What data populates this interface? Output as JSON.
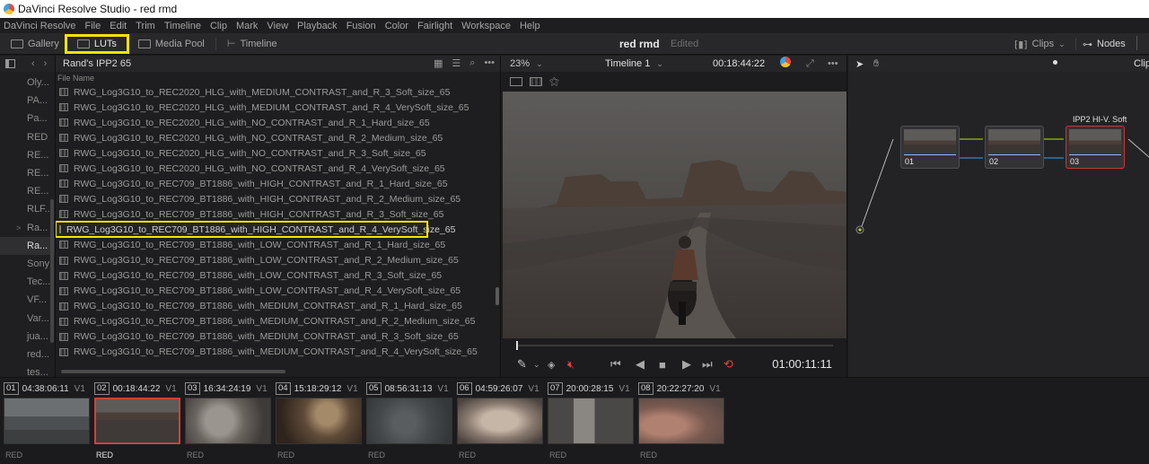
{
  "window": {
    "title": "DaVinci Resolve Studio - red rmd"
  },
  "menu": [
    "DaVinci Resolve",
    "File",
    "Edit",
    "Trim",
    "Timeline",
    "Clip",
    "Mark",
    "View",
    "Playback",
    "Fusion",
    "Color",
    "Fairlight",
    "Workspace",
    "Help"
  ],
  "toolbar": {
    "gallery": "Gallery",
    "luts": "LUTs",
    "media_pool": "Media Pool",
    "timeline": "Timeline",
    "project_name": "red rmd",
    "project_status": "Edited",
    "clips": "Clips",
    "nodes": "Nodes"
  },
  "bins": [
    {
      "label": "Oly..."
    },
    {
      "label": "PA..."
    },
    {
      "label": "Pa..."
    },
    {
      "label": "RED"
    },
    {
      "label": "RE..."
    },
    {
      "label": "RE..."
    },
    {
      "label": "RE..."
    },
    {
      "label": "RLF..."
    },
    {
      "label": "Ra..."
    },
    {
      "label": "Ra..."
    },
    {
      "label": "Sony"
    },
    {
      "label": "Tec..."
    },
    {
      "label": "VF..."
    },
    {
      "label": "Var..."
    },
    {
      "label": "jua..."
    },
    {
      "label": "red..."
    },
    {
      "label": "tes..."
    }
  ],
  "lut_panel": {
    "title": "Rand's IPP2 65",
    "column_header": "File Name",
    "files": [
      "RWG_Log3G10_to_REC2020_HLG_with_MEDIUM_CONTRAST_and_R_3_Soft_size_65",
      "RWG_Log3G10_to_REC2020_HLG_with_MEDIUM_CONTRAST_and_R_4_VerySoft_size_65",
      "RWG_Log3G10_to_REC2020_HLG_with_NO_CONTRAST_and_R_1_Hard_size_65",
      "RWG_Log3G10_to_REC2020_HLG_with_NO_CONTRAST_and_R_2_Medium_size_65",
      "RWG_Log3G10_to_REC2020_HLG_with_NO_CONTRAST_and_R_3_Soft_size_65",
      "RWG_Log3G10_to_REC2020_HLG_with_NO_CONTRAST_and_R_4_VerySoft_size_65",
      "RWG_Log3G10_to_REC709_BT1886_with_HIGH_CONTRAST_and_R_1_Hard_size_65",
      "RWG_Log3G10_to_REC709_BT1886_with_HIGH_CONTRAST_and_R_2_Medium_size_65",
      "RWG_Log3G10_to_REC709_BT1886_with_HIGH_CONTRAST_and_R_3_Soft_size_65",
      "RWG_Log3G10_to_REC709_BT1886_with_HIGH_CONTRAST_and_R_4_VerySoft_size_65",
      "RWG_Log3G10_to_REC709_BT1886_with_LOW_CONTRAST_and_R_1_Hard_size_65",
      "RWG_Log3G10_to_REC709_BT1886_with_LOW_CONTRAST_and_R_2_Medium_size_65",
      "RWG_Log3G10_to_REC709_BT1886_with_LOW_CONTRAST_and_R_3_Soft_size_65",
      "RWG_Log3G10_to_REC709_BT1886_with_LOW_CONTRAST_and_R_4_VerySoft_size_65",
      "RWG_Log3G10_to_REC709_BT1886_with_MEDIUM_CONTRAST_and_R_1_Hard_size_65",
      "RWG_Log3G10_to_REC709_BT1886_with_MEDIUM_CONTRAST_and_R_2_Medium_size_65",
      "RWG_Log3G10_to_REC709_BT1886_with_MEDIUM_CONTRAST_and_R_3_Soft_size_65",
      "RWG_Log3G10_to_REC709_BT1886_with_MEDIUM_CONTRAST_and_R_4_VerySoft_size_65"
    ]
  },
  "viewer": {
    "zoom": "23%",
    "timeline_name": "Timeline 1",
    "timecode_top": "00:18:44:22",
    "timecode": "01:00:11:11"
  },
  "node_editor": {
    "panel_label": "Clip",
    "node_title": "IPP2 HI-V. Soft",
    "nodes": [
      {
        "num": "01"
      },
      {
        "num": "02"
      },
      {
        "num": "03"
      }
    ]
  },
  "clips": [
    {
      "num": "01",
      "tc": "04:38:06:11",
      "track": "V1",
      "codec": "RED"
    },
    {
      "num": "02",
      "tc": "00:18:44:22",
      "track": "V1",
      "codec": "RED"
    },
    {
      "num": "03",
      "tc": "16:34:24:19",
      "track": "V1",
      "codec": "RED"
    },
    {
      "num": "04",
      "tc": "15:18:29:12",
      "track": "V1",
      "codec": "RED"
    },
    {
      "num": "05",
      "tc": "08:56:31:13",
      "track": "V1",
      "codec": "RED"
    },
    {
      "num": "06",
      "tc": "04:59:26:07",
      "track": "V1",
      "codec": "RED"
    },
    {
      "num": "07",
      "tc": "20:00:28:15",
      "track": "V1",
      "codec": "RED"
    },
    {
      "num": "08",
      "tc": "20:22:27:20",
      "track": "V1",
      "codec": "RED"
    }
  ],
  "colors": {
    "highlight": "#f5e400",
    "selection_red": "#cf4238",
    "panel_bg": "#1e1e20"
  }
}
